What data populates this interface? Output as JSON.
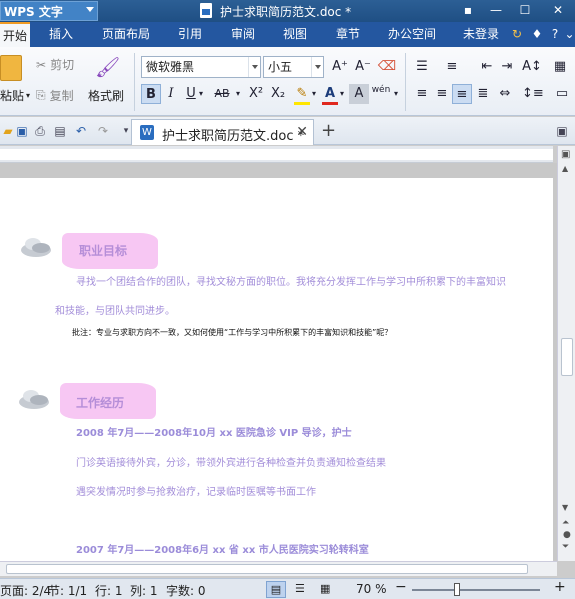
{
  "titlebar": {
    "app_name": "WPS 文字",
    "doc_title": "护士求职简历范文.doc *"
  },
  "menu": [
    "开始",
    "插入",
    "页面布局",
    "引用",
    "审阅",
    "视图",
    "章节",
    "办公空间"
  ],
  "account": {
    "login": "未登录"
  },
  "ribbon": {
    "paste": "粘贴",
    "cut": "剪切",
    "copy": "复制",
    "format_painter": "格式刷",
    "font_name": "微软雅黑",
    "font_size": "小五",
    "bold": "B",
    "italic": "I",
    "underline": "U",
    "strike": "AB",
    "superscript": "X²",
    "subscript": "X₂",
    "font_color": "A",
    "char_shading": "A",
    "phonetic": "wén"
  },
  "doc_tab": {
    "label": "护士求职简历范文.doc *"
  },
  "document": {
    "section1_title": "职业目标",
    "section1_line1": "寻找一个团结合作的团队，寻找文秘方面的职位。我将充分发挥工作与学习中所积累下的丰富知识",
    "section1_line2": "和技能，与团队共同进步。",
    "note": "批注：专业与求职方向不一致，又如何使用“工作与学习中所积累下的丰富知识和技能”呢？",
    "section2_title": "工作经历",
    "job1_head": "2008 年7月——2008年10月        xx 医院急诊 VIP 导诊，护士",
    "job1_line1": "门诊英语接待外宾，分诊，带领外宾进行各种检查并负责通知检查结果",
    "job1_line2": "遇突发情况时参与抢救治疗，记录临时医嘱等书面工作",
    "job2_head": "2007 年7月——2008年6月        xx 省 xx 市人民医院实习轮转科室"
  },
  "status": {
    "page": "页面: 2/4",
    "section": "节: 1/1",
    "row": "行: 1",
    "col": "列: 1",
    "words": "字数: 0",
    "zoom": "70 %"
  },
  "colors": {
    "accent": "#2457a0",
    "heading": "#b58ed8",
    "body": "#a38ed9",
    "banner": "#f7c7f3"
  }
}
